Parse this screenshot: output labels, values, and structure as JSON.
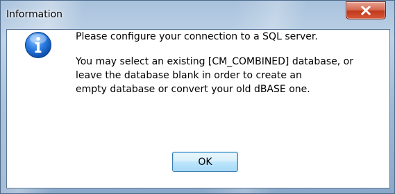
{
  "window": {
    "title": "Information",
    "close_icon": "close-x-icon"
  },
  "dialog": {
    "icon": "information-icon",
    "message_line_1": "Please configure your connection to a SQL server.",
    "message_line_2": "You may select an existing [CM_COMBINED] database, or",
    "message_line_3": "leave the database blank in order to create an",
    "message_line_4": "empty database or convert your old dBASE one.",
    "ok_label": "OK"
  },
  "colors": {
    "frame": "#a9c2dc",
    "close_button": "#c0391c",
    "info_icon": "#1f6fd0",
    "ok_button_border": "#3c7fb1"
  }
}
